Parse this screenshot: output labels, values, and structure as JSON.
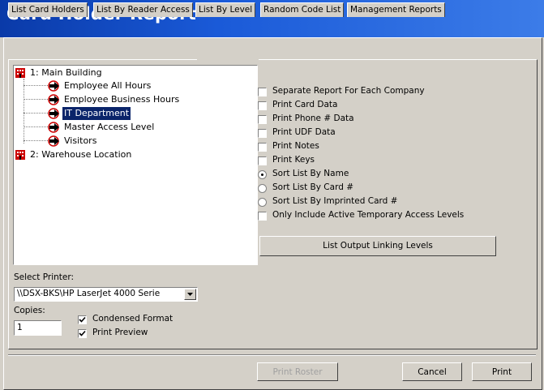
{
  "window": {
    "title": "Card Holder Report"
  },
  "tabs": [
    {
      "label": "List Card Holders"
    },
    {
      "label": "List By Reader Access"
    },
    {
      "label": "List By Level"
    },
    {
      "label": "Random Code List"
    },
    {
      "label": "Management Reports"
    }
  ],
  "active_tab": "List By Level",
  "tree": {
    "locations": [
      {
        "label": "1:  Main Building",
        "levels": [
          {
            "label": "Employee All Hours"
          },
          {
            "label": "Employee Business Hours"
          },
          {
            "label": "IT Department",
            "selected": true
          },
          {
            "label": "Master Access Level"
          },
          {
            "label": "Visitors"
          }
        ]
      },
      {
        "label": "2:  Warehouse Location",
        "levels": []
      }
    ]
  },
  "options": {
    "separate_report": {
      "label": "Separate Report For Each Company",
      "checked": false
    },
    "print_card_data": {
      "label": "Print Card Data",
      "checked": false
    },
    "print_phone": {
      "label": "Print Phone # Data",
      "checked": false
    },
    "print_udf": {
      "label": "Print UDF Data",
      "checked": false
    },
    "print_notes": {
      "label": "Print Notes",
      "checked": false
    },
    "print_keys": {
      "label": "Print Keys",
      "checked": false
    },
    "sort_name": {
      "label": "Sort List By Name",
      "selected": true
    },
    "sort_card": {
      "label": "Sort List By Card #",
      "selected": false
    },
    "sort_imprinted": {
      "label": "Sort List By Imprinted Card #",
      "selected": false
    },
    "only_active": {
      "label": "Only Include Active Temporary Access Levels",
      "checked": false
    }
  },
  "list_output_button": "List Output Linking Levels",
  "printer": {
    "label": "Select Printer:",
    "value": "\\\\DSX-BKS\\HP LaserJet 4000 Serie"
  },
  "copies": {
    "label": "Copies:",
    "value": "1"
  },
  "condensed_format": {
    "label": "Condensed Format",
    "checked": true
  },
  "print_preview": {
    "label": "Print Preview",
    "checked": true
  },
  "buttons": {
    "print_roster": "Print Roster",
    "cancel": "Cancel",
    "print": "Print"
  },
  "colors": {
    "title_bar": "#0a3aa8",
    "selection": "#0a246a",
    "icon_red": "#cc0000"
  }
}
